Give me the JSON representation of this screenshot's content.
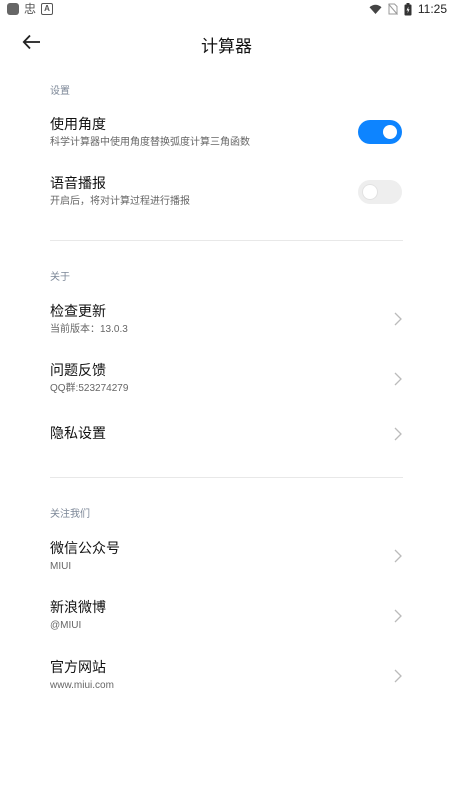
{
  "status_bar": {
    "time": "11:25",
    "left_glyph": "忠",
    "badge": "A"
  },
  "header": {
    "title": "计算器"
  },
  "sections": {
    "settings": {
      "header": "设置",
      "use_angle": {
        "label": "使用角度",
        "sub": "科学计算器中使用角度替换弧度计算三角函数",
        "enabled": true
      },
      "voice": {
        "label": "语音播报",
        "sub": "开启后，将对计算过程进行播报",
        "enabled": false
      }
    },
    "about": {
      "header": "关于",
      "check_update": {
        "label": "检查更新",
        "sub": "当前版本：13.0.3"
      },
      "feedback": {
        "label": "问题反馈",
        "sub": "QQ群:523274279"
      },
      "privacy": {
        "label": "隐私设置"
      }
    },
    "follow": {
      "header": "关注我们",
      "wechat": {
        "label": "微信公众号",
        "sub": "MIUI"
      },
      "weibo": {
        "label": "新浪微博",
        "sub": "@MIUI"
      },
      "website": {
        "label": "官方网站",
        "sub": "www.miui.com"
      }
    }
  },
  "colors": {
    "accent": "#0d84ff",
    "section_header": "#7c8797"
  }
}
